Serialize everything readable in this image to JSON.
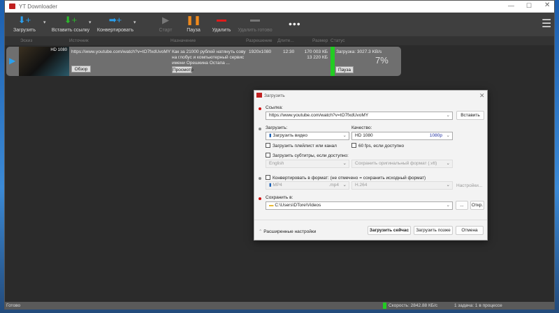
{
  "app": {
    "title": "YT Downloader"
  },
  "toolbar": {
    "download": "Загрузить",
    "paste": "Вставить ссылку",
    "convert": "Конвертировать",
    "start": "Старт",
    "pause": "Пауза",
    "delete": "Удалить",
    "delete_done": "Удалить готово"
  },
  "columns": [
    "Эскиз",
    "Источник",
    "Назначение",
    "Разрешение",
    "Длите...",
    "Размер",
    "Статус"
  ],
  "item": {
    "thumb_badge": "HD 1080",
    "source": "https://www.youtube.com/watch?v=tO7fxdUvoMY",
    "browse": "Обзор",
    "destination": "Как за 21000 рублей натянуть сову на глобус и компьютерный сервис имени Орешкина Остапа ...",
    "preview": "Просмотр",
    "resolution": "1920x1080",
    "duration": "12:30",
    "size_total": "170 003 КБ",
    "size_done": "13 220 КБ",
    "status": "Загрузка: 3027.3 KB/s",
    "pause": "Пауза",
    "progress": "7%",
    "progress_value": 7
  },
  "statusbar": {
    "left": "Готово",
    "speed": "Скорость: 2842.88 КБ/с",
    "tasks": "1 задача: 1 в процессе"
  },
  "dialog": {
    "title": "Загрузить",
    "link_label": "Ссылка:",
    "link_value": "https://www.youtube.com/watch?v=tO7fxdUvoMY",
    "paste": "Вставить",
    "download_label": "Загрузить:",
    "download_value": "Загрузить видео",
    "quality_label": "Качество:",
    "quality_value": "HD 1080",
    "quality_badge": "1080p",
    "playlist": "Загрузить плейлист или канал",
    "fps": "60 fps, если доступно",
    "subs": "Загрузить субтитры, если доступно:",
    "subs_lang": "English",
    "subs_format": "Сохранить оригинальный формат (.vtt)",
    "convert": "Конвертировать в формат: (не отмечено = сохранить исходный формат)",
    "conv_format": "MP4",
    "conv_ext": ".mp4",
    "conv_codec": "H.264",
    "conv_settings": "Настройки...",
    "save_label": "Сохранить в:",
    "save_path": "C:\\Users\\DTore\\Videos",
    "browse": "...",
    "open": "Откр.",
    "advanced": "Расширенные настройки",
    "download_now": "Загрузить сейчас",
    "download_later": "Загрузить позже",
    "cancel": "Отмена"
  },
  "colors": {
    "accent_red": "#d01010",
    "progress_green": "#22cc22",
    "blue_icon": "#2aa0ef",
    "green_icon": "#2cb82c",
    "orange": "#f08a1c"
  }
}
